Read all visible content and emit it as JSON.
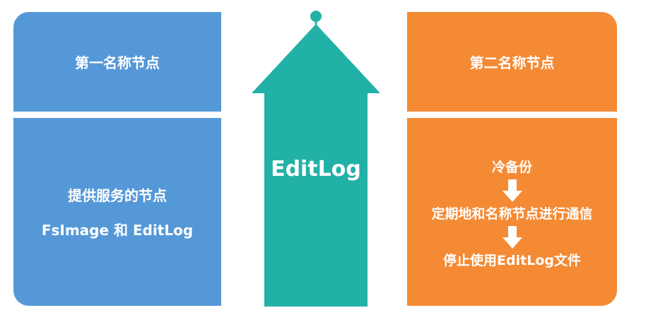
{
  "colors": {
    "blue": "#5598d8",
    "teal": "#22b1a6",
    "orange": "#f58a34",
    "text": "#ffffff"
  },
  "primary_namenode": {
    "title": "第一名称节点",
    "description": "提供服务的节点",
    "files": "FsImage 和 EditLog"
  },
  "arrow": {
    "label": "EditLog"
  },
  "secondary_namenode": {
    "title": "第二名称节点",
    "steps": [
      "冷备份",
      "定期地和名称节点进行通信",
      "停止使用EditLog文件"
    ]
  },
  "icons": {
    "step_arrow": "down-arrow-icon",
    "center_arrow": "up-arrow-icon"
  }
}
